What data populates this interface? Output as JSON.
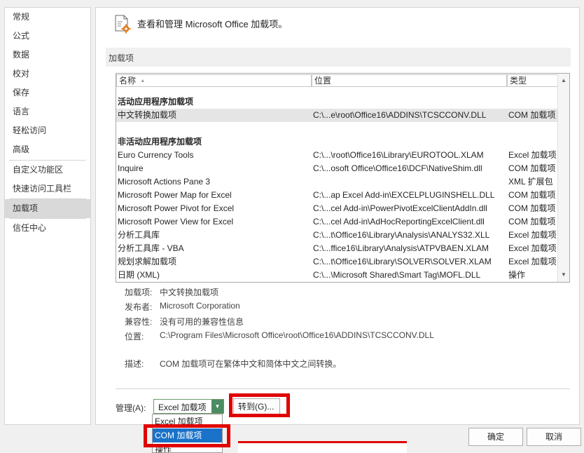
{
  "sidebar": {
    "items": [
      {
        "label": "常规"
      },
      {
        "label": "公式"
      },
      {
        "label": "数据"
      },
      {
        "label": "校对"
      },
      {
        "label": "保存"
      },
      {
        "label": "语言"
      },
      {
        "label": "轻松访问"
      },
      {
        "label": "高级"
      },
      {
        "label": "自定义功能区"
      },
      {
        "label": "快速访问工具栏"
      },
      {
        "label": "加载项",
        "active": true
      },
      {
        "label": "信任中心"
      }
    ]
  },
  "header": {
    "icon": "addins-gear-icon",
    "title": "查看和管理 Microsoft Office 加载项。"
  },
  "section": {
    "title": "加载项"
  },
  "grid": {
    "columns": [
      "名称",
      "位置",
      "类型"
    ],
    "sort_indicator": "▲",
    "active_group": "活动应用程序加载项",
    "active_rows": [
      {
        "name": "中文转换加载项",
        "location": "C:\\...e\\root\\Office16\\ADDINS\\TCSCCONV.DLL",
        "type": "COM 加载项"
      }
    ],
    "inactive_group": "非活动应用程序加载项",
    "inactive_rows": [
      {
        "name": "Euro Currency Tools",
        "location": "C:\\...\\root\\Office16\\Library\\EUROTOOL.XLAM",
        "type": "Excel 加载项"
      },
      {
        "name": "Inquire",
        "location": "C:\\...osoft Office\\Office16\\DCF\\NativeShim.dll",
        "type": "COM 加载项"
      },
      {
        "name": "Microsoft Actions Pane 3",
        "location": "",
        "type": "XML 扩展包"
      },
      {
        "name": "Microsoft Power Map for Excel",
        "location": "C:\\...ap Excel Add-in\\EXCELPLUGINSHELL.DLL",
        "type": "COM 加载项"
      },
      {
        "name": "Microsoft Power Pivot for Excel",
        "location": "C:\\...cel Add-in\\PowerPivotExcelClientAddIn.dll",
        "type": "COM 加载项"
      },
      {
        "name": "Microsoft Power View for Excel",
        "location": "C:\\...cel Add-in\\AdHocReportingExcelClient.dll",
        "type": "COM 加载项"
      },
      {
        "name": "分析工具库",
        "location": "C:\\...t\\Office16\\Library\\Analysis\\ANALYS32.XLL",
        "type": "Excel 加载项"
      },
      {
        "name": "分析工具库 - VBA",
        "location": "C:\\...ffice16\\Library\\Analysis\\ATPVBAEN.XLAM",
        "type": "Excel 加载项"
      },
      {
        "name": "规划求解加载项",
        "location": "C:\\...t\\Office16\\Library\\SOLVER\\SOLVER.XLAM",
        "type": "Excel 加载项"
      },
      {
        "name": "日期 (XML)",
        "location": "C:\\...\\Microsoft Shared\\Smart Tag\\MOFL.DLL",
        "type": "操作"
      }
    ]
  },
  "details": {
    "addin_label": "加载项:",
    "addin_value": "中文转换加载项",
    "publisher_label": "发布者:",
    "publisher_value": "Microsoft Corporation",
    "compat_label": "兼容性:",
    "compat_value": "没有可用的兼容性信息",
    "location_label": "位置:",
    "location_value": "C:\\Program Files\\Microsoft Office\\root\\Office16\\ADDINS\\TCSCCONV.DLL",
    "desc_label": "描述:",
    "desc_value": "COM 加载项可在繁体中文和简体中文之间转换。"
  },
  "manage": {
    "label": "管理(A):",
    "selected": "Excel 加载项",
    "go_label": "转到(G)...",
    "options": [
      "Excel 加载项",
      "COM 加载项",
      "操作"
    ],
    "highlighted_option": "COM 加载项"
  },
  "footer": {
    "ok": "确定",
    "cancel": "取消"
  },
  "colors": {
    "highlight_box": "#e00000",
    "dropdown_selected": "#1a72c9",
    "combo_button": "#4c8c62"
  }
}
